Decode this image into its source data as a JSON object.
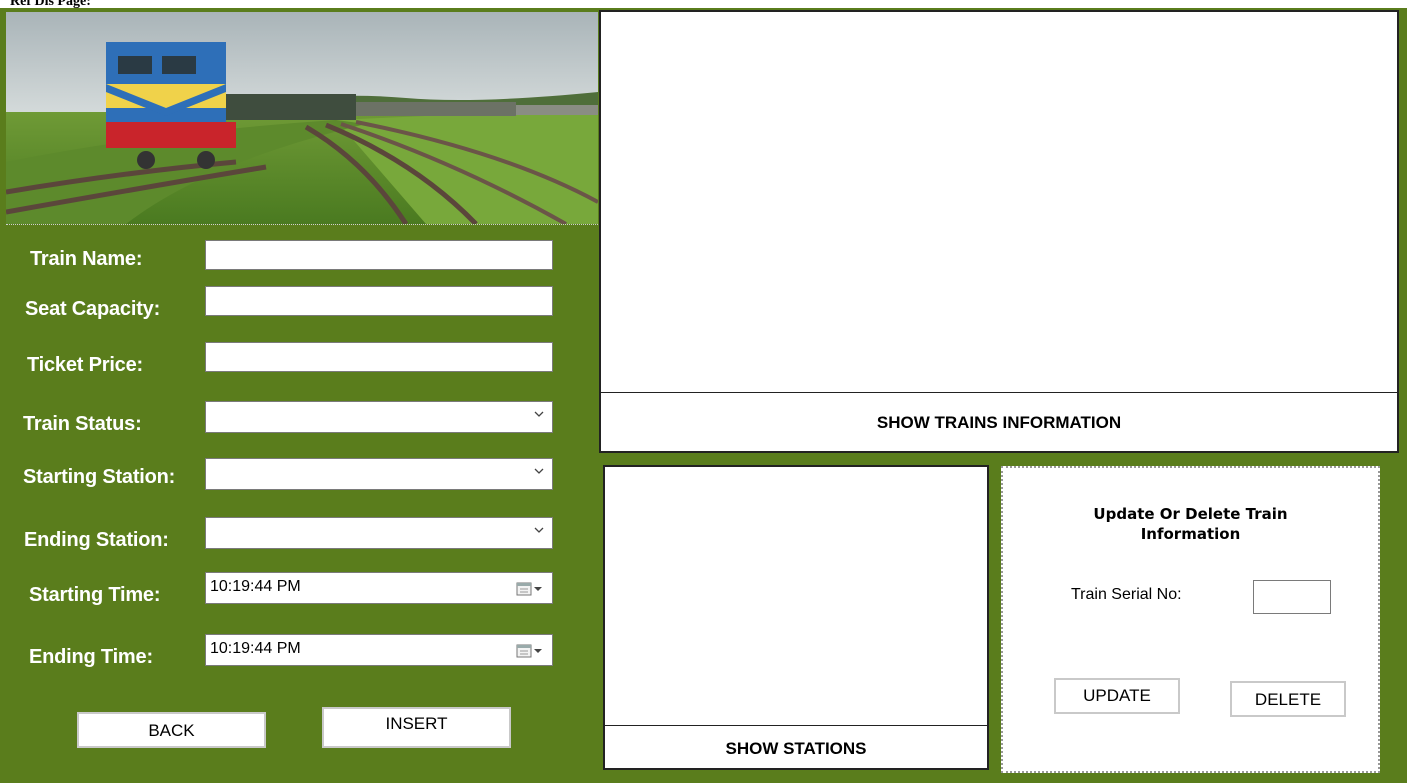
{
  "window": {
    "title_fragment": "Ref Dis Page:"
  },
  "form": {
    "train_name_label": "Train Name:",
    "seat_capacity_label": "Seat Capacity:",
    "ticket_price_label": "Ticket Price:",
    "train_status_label": "Train Status:",
    "starting_station_label": "Starting Station:",
    "ending_station_label": "Ending Station:",
    "starting_time_label": "Starting Time:",
    "ending_time_label": "Ending Time:",
    "train_name_value": "",
    "seat_capacity_value": "",
    "ticket_price_value": "",
    "train_status_value": "",
    "starting_station_value": "",
    "ending_station_value": "",
    "starting_time_value": "10:19:44 PM",
    "ending_time_value": "10:19:44 PM"
  },
  "buttons": {
    "back": "BACK",
    "insert": "INSERT",
    "show_trains": "SHOW TRAINS INFORMATION",
    "show_stations": "SHOW STATIONS",
    "update": "UPDATE",
    "delete": "DELETE"
  },
  "update_panel": {
    "title": "Update Or Delete Train Information",
    "serial_label": "Train Serial No:",
    "serial_value": ""
  },
  "icons": {
    "dropdown": "chevron-down-icon",
    "calendar": "calendar-icon"
  },
  "colors": {
    "background": "#5a7d1c",
    "panel": "#ffffff"
  }
}
